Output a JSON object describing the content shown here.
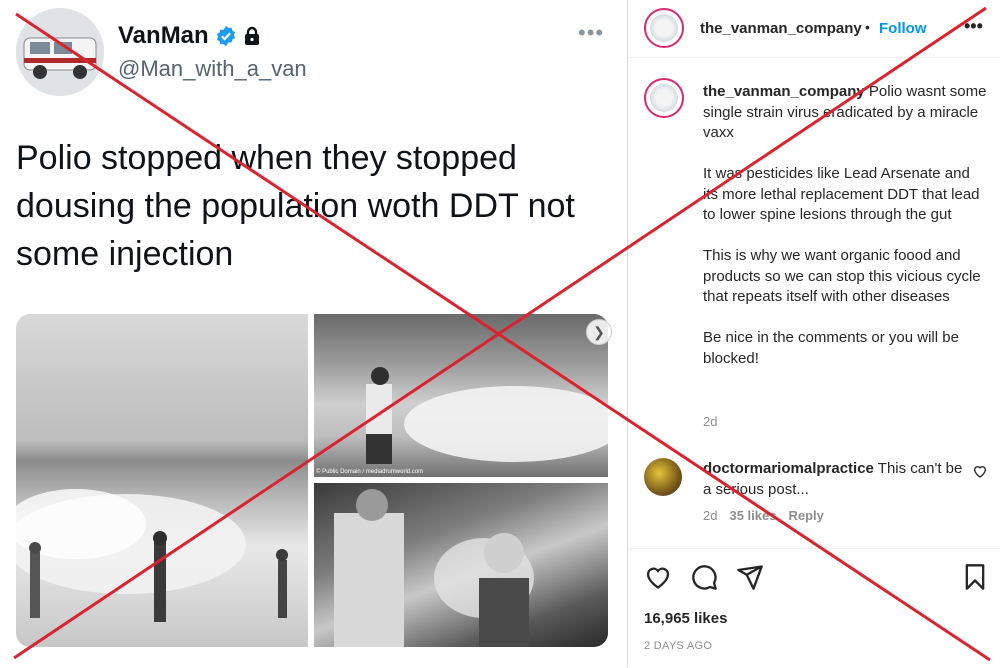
{
  "tweet": {
    "name": "VanMan",
    "handle": "@Man_with_a_van",
    "more": "•••",
    "text": "Polio stopped when they stopped dousing the population woth DDT not some injection",
    "photo_credit": "© Public Domain / mediadrumworld.com"
  },
  "instagram": {
    "username": "the_vanman_company",
    "separator": "•",
    "follow": "Follow",
    "more": "•••",
    "caption_paragraphs": [
      "Polio wasnt some single strain virus eradicated by a miracle vaxx",
      "It was pesticides like Lead Arsenate and its more lethal replacement DDT that lead to lower spine lesions through the gut",
      "This is why we want organic foood and products so we can stop this vicious cycle that repeats itself with other diseases",
      "Be nice in the comments or you will be blocked!"
    ],
    "caption_time": "2d",
    "comment": {
      "username": "doctormariomalpractice",
      "text": "This can't be a serious post...",
      "time": "2d",
      "likes": "35 likes",
      "reply": "Reply"
    },
    "likes": "16,965 likes",
    "posted": "2 DAYS AGO"
  },
  "overlay": {
    "cross_color": "#d9232e"
  }
}
